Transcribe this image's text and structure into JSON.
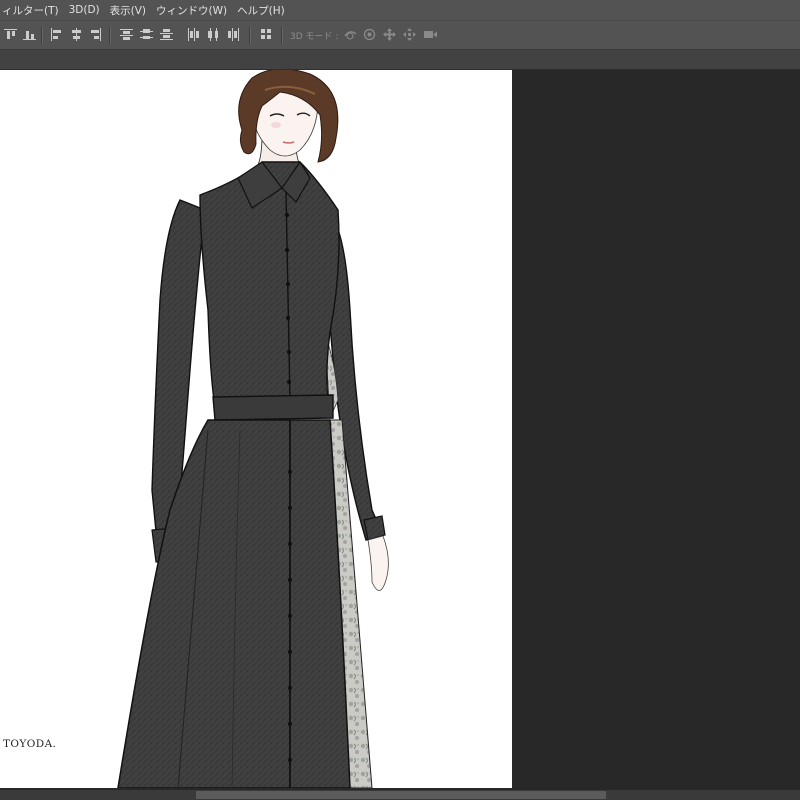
{
  "menubar": {
    "items": [
      "ィルター(T)",
      "3D(D)",
      "表示(V)",
      "ウィンドウ(W)",
      "ヘルプ(H)"
    ]
  },
  "options_bar": {
    "mode3d_label": "3D モード :",
    "align_icons": [
      "align-top-icon",
      "align-vcenter-icon",
      "align-bottom-icon",
      "align-left-icon",
      "align-hcenter-icon",
      "align-right-icon"
    ],
    "distribute_icons": [
      "distribute-top-icon",
      "distribute-vcenter-icon",
      "distribute-bottom-icon",
      "distribute-left-icon",
      "distribute-hcenter-icon",
      "distribute-right-icon"
    ],
    "auto_align_icon": "auto-align-icon",
    "mode3d_icons": [
      "orbit-3d-icon",
      "roll-3d-icon",
      "drag-3d-icon",
      "slide-3d-icon",
      "scale-3d-icon"
    ]
  },
  "document": {
    "signature": "TOYODA.",
    "illustration": "fashion-illustration"
  },
  "colors": {
    "chrome": "#535353",
    "workspace": "#282828",
    "canvas": "#ffffff",
    "dress": "#3b3b3b",
    "hair": "#5a3a28"
  }
}
